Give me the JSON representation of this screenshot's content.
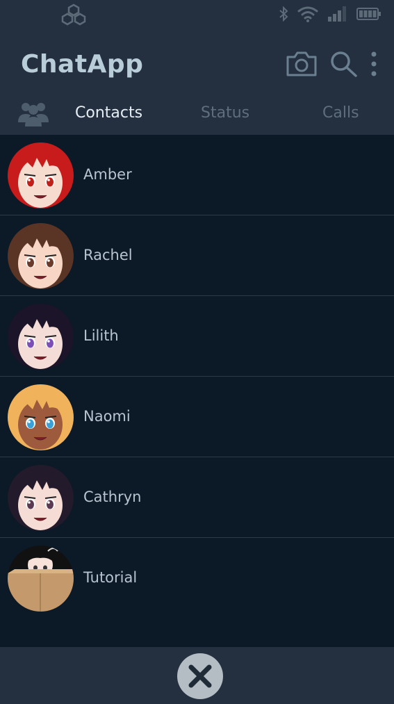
{
  "status_bar": {
    "logo_icon": "hexagon-cluster-logo-icon",
    "icons": [
      "bluetooth-icon",
      "wifi-icon",
      "signal-icon",
      "battery-icon"
    ]
  },
  "header": {
    "title": "ChatApp",
    "actions": [
      "camera-icon",
      "search-icon",
      "more-vertical-icon"
    ]
  },
  "tabs": {
    "group_icon": "group-icon",
    "items": [
      {
        "label": "Contacts",
        "active": true
      },
      {
        "label": "Status",
        "active": false
      },
      {
        "label": "Calls",
        "active": false
      }
    ]
  },
  "contacts": [
    {
      "name": "Amber",
      "hair": "#c81c1c",
      "skin": "#f6dccf",
      "eyes": "#c0201a"
    },
    {
      "name": "Rachel",
      "hair": "#5a3424",
      "skin": "#f7d6c6",
      "eyes": "#6a3a2a"
    },
    {
      "name": "Lilith",
      "hair": "#1c1428",
      "skin": "#f4ddd6",
      "eyes": "#7b4fb8"
    },
    {
      "name": "Naomi",
      "hair": "#f0b35c",
      "skin": "#9e5a3c",
      "eyes": "#3aa0d8"
    },
    {
      "name": "Cathryn",
      "hair": "#231a2c",
      "skin": "#f5dcd4",
      "eyes": "#5a3a52"
    },
    {
      "name": "Tutorial",
      "hair": "#111111",
      "skin": "#f6e2d8",
      "eyes": "#333333"
    }
  ],
  "bottom_bar": {
    "close_icon": "close-icon"
  },
  "colors": {
    "background": "#0c1926",
    "header": "#243040",
    "divider": "#2c3a48",
    "title": "#b9cdd8",
    "tab_active": "#e6edf3",
    "tab_inactive": "#5f6e7d"
  }
}
